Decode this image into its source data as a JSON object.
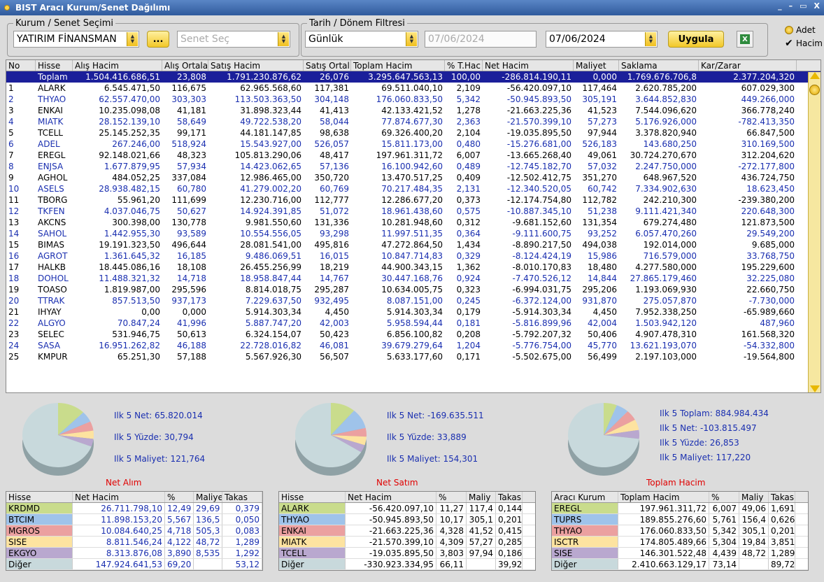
{
  "window": {
    "title": "BIST Aracı Kurum/Senet Dağılımı",
    "controls": [
      "_",
      "–",
      "▭",
      "X"
    ]
  },
  "filters": {
    "kurum_legend": "Kurum / Senet Seçimi",
    "kurum_value": "YATIRIM FİNANSMAN",
    "more_button": "...",
    "senet_placeholder": "Senet Seç",
    "tarih_legend": "Tarih / Dönem Filtresi",
    "period_value": "Günlük",
    "start_date": "07/06/2024",
    "end_date": "07/06/2024",
    "apply_button": "Uygula",
    "option_adet": "Adet",
    "option_hacim": "Hacim"
  },
  "table": {
    "columns": [
      "No",
      "Hisse",
      "Alış Hacim",
      "Alış Ortala",
      "Satış Hacim",
      "Satış Ortal",
      "Toplam Hacim",
      "% T.Hac",
      "Net Hacim",
      "Maliyet",
      "Saklama",
      "Kar/Zarar"
    ],
    "total": [
      "",
      "Toplam",
      "1.504.416.686,51",
      "23,808",
      "1.791.230.876,62",
      "26,076",
      "3.295.647.563,13",
      "100,00",
      "-286.814.190,11",
      "0,000",
      "1.769.676.706,8",
      "2.377.204,320"
    ],
    "rows": [
      [
        "1",
        "ALARK",
        "6.545.471,50",
        "116,675",
        "62.965.568,60",
        "117,381",
        "69.511.040,10",
        "2,109",
        "-56.420.097,10",
        "117,464",
        "2.620.785,200",
        "607.029,300"
      ],
      [
        "2",
        "THYAO",
        "62.557.470,00",
        "303,303",
        "113.503.363,50",
        "304,148",
        "176.060.833,50",
        "5,342",
        "-50.945.893,50",
        "305,191",
        "3.644.852,830",
        "449.266,000"
      ],
      [
        "3",
        "ENKAI",
        "10.235.098,08",
        "41,181",
        "31.898.323,44",
        "41,413",
        "42.133.421,52",
        "1,278",
        "-21.663.225,36",
        "41,523",
        "7.544.096,620",
        "366.778,240"
      ],
      [
        "4",
        "MIATK",
        "28.152.139,10",
        "58,649",
        "49.722.538,20",
        "58,044",
        "77.874.677,30",
        "2,363",
        "-21.570.399,10",
        "57,273",
        "5.176.926,000",
        "-782.413,350"
      ],
      [
        "5",
        "TCELL",
        "25.145.252,35",
        "99,171",
        "44.181.147,85",
        "98,638",
        "69.326.400,20",
        "2,104",
        "-19.035.895,50",
        "97,944",
        "3.378.820,940",
        "66.847,500"
      ],
      [
        "6",
        "ADEL",
        "267.246,00",
        "518,924",
        "15.543.927,00",
        "526,057",
        "15.811.173,00",
        "0,480",
        "-15.276.681,00",
        "526,183",
        "143.680,250",
        "310.169,500"
      ],
      [
        "7",
        "EREGL",
        "92.148.021,66",
        "48,323",
        "105.813.290,06",
        "48,417",
        "197.961.311,72",
        "6,007",
        "-13.665.268,40",
        "49,061",
        "30.724.270,670",
        "312.204,620"
      ],
      [
        "8",
        "ENJSA",
        "1.677.879,95",
        "57,934",
        "14.423.062,65",
        "57,136",
        "16.100.942,60",
        "0,489",
        "-12.745.182,70",
        "57,032",
        "2.247.750,000",
        "-272.177,800"
      ],
      [
        "9",
        "AGHOL",
        "484.052,25",
        "337,084",
        "12.986.465,00",
        "350,720",
        "13.470.517,25",
        "0,409",
        "-12.502.412,75",
        "351,270",
        "648.967,520",
        "436.724,750"
      ],
      [
        "10",
        "ASELS",
        "28.938.482,15",
        "60,780",
        "41.279.002,20",
        "60,769",
        "70.217.484,35",
        "2,131",
        "-12.340.520,05",
        "60,742",
        "7.334.902,630",
        "18.623,450"
      ],
      [
        "11",
        "TBORG",
        "55.961,20",
        "111,699",
        "12.230.716,00",
        "112,777",
        "12.286.677,20",
        "0,373",
        "-12.174.754,80",
        "112,782",
        "242.210,300",
        "-239.380,200"
      ],
      [
        "12",
        "TKFEN",
        "4.037.046,75",
        "50,627",
        "14.924.391,85",
        "51,072",
        "18.961.438,60",
        "0,575",
        "-10.887.345,10",
        "51,238",
        "9.111.421,340",
        "220.648,300"
      ],
      [
        "13",
        "AKCNS",
        "300.398,00",
        "130,778",
        "9.981.550,60",
        "131,336",
        "10.281.948,60",
        "0,312",
        "-9.681.152,60",
        "131,354",
        "679.274,480",
        "121.873,500"
      ],
      [
        "14",
        "SAHOL",
        "1.442.955,30",
        "93,589",
        "10.554.556,05",
        "93,298",
        "11.997.511,35",
        "0,364",
        "-9.111.600,75",
        "93,252",
        "6.057.470,260",
        "29.549,200"
      ],
      [
        "15",
        "BIMAS",
        "19.191.323,50",
        "496,644",
        "28.081.541,00",
        "495,816",
        "47.272.864,50",
        "1,434",
        "-8.890.217,50",
        "494,038",
        "192.014,000",
        "9.685,000"
      ],
      [
        "16",
        "AGROT",
        "1.361.645,32",
        "16,185",
        "9.486.069,51",
        "16,015",
        "10.847.714,83",
        "0,329",
        "-8.124.424,19",
        "15,986",
        "716.579,000",
        "33.768,750"
      ],
      [
        "17",
        "HALKB",
        "18.445.086,16",
        "18,108",
        "26.455.256,99",
        "18,219",
        "44.900.343,15",
        "1,362",
        "-8.010.170,83",
        "18,480",
        "4.277.580,000",
        "195.229,600"
      ],
      [
        "18",
        "DOHOL",
        "11.488.321,32",
        "14,718",
        "18.958.847,44",
        "14,767",
        "30.447.168,76",
        "0,924",
        "-7.470.526,12",
        "14,844",
        "27.865.179,460",
        "32.225,080"
      ],
      [
        "19",
        "TOASO",
        "1.819.987,00",
        "295,596",
        "8.814.018,75",
        "295,287",
        "10.634.005,75",
        "0,323",
        "-6.994.031,75",
        "295,206",
        "1.193.069,930",
        "22.660,750"
      ],
      [
        "20",
        "TTRAK",
        "857.513,50",
        "937,173",
        "7.229.637,50",
        "932,495",
        "8.087.151,00",
        "0,245",
        "-6.372.124,00",
        "931,870",
        "275.057,870",
        "-7.730,000"
      ],
      [
        "21",
        "IHYAY",
        "0,00",
        "0,000",
        "5.914.303,34",
        "4,450",
        "5.914.303,34",
        "0,179",
        "-5.914.303,34",
        "4,450",
        "7.952.338,250",
        "-65.989,660"
      ],
      [
        "22",
        "ALGYO",
        "70.847,24",
        "41,996",
        "5.887.747,20",
        "42,003",
        "5.958.594,44",
        "0,181",
        "-5.816.899,96",
        "42,004",
        "1.503.942,120",
        "487,960"
      ],
      [
        "23",
        "SELEC",
        "531.946,75",
        "50,613",
        "6.324.154,07",
        "50,423",
        "6.856.100,82",
        "0,208",
        "-5.792.207,32",
        "50,406",
        "4.907.478,310",
        "161.568,320"
      ],
      [
        "24",
        "SASA",
        "16.951.262,82",
        "46,188",
        "22.728.016,82",
        "46,081",
        "39.679.279,64",
        "1,204",
        "-5.776.754,00",
        "45,770",
        "13.621.193,070",
        "-54.332,800"
      ],
      [
        "25",
        "KMPUR",
        "65.251,30",
        "57,188",
        "5.567.926,30",
        "56,507",
        "5.633.177,60",
        "0,171",
        "-5.502.675,00",
        "56,499",
        "2.197.103,000",
        "-19.564,800"
      ]
    ]
  },
  "summaries": [
    {
      "title": "Net Alım",
      "stats": [
        "Ilk 5 Net: 65.820.014",
        "Ilk 5 Yüzde: 30,794",
        "Ilk 5 Maliyet: 121,764"
      ],
      "headers": [
        "Hisse",
        "Net Hacim",
        "%",
        "Maliye",
        "Takas"
      ],
      "pie": [
        12.49,
        5.567,
        4.718,
        4.122,
        3.89,
        69.2
      ],
      "rows": [
        {
          "c": [
            "KRDMD",
            "26.711.798,10",
            "12,49",
            "29,69",
            "0,379"
          ],
          "color": "#c9dc8c"
        },
        {
          "c": [
            "BTCIM",
            "11.898.153,20",
            "5,567",
            "136,5",
            "0,050"
          ],
          "color": "#9fc3ea"
        },
        {
          "c": [
            "MGROS",
            "10.084.640,25",
            "4,718",
            "505,3",
            "0,083"
          ],
          "color": "#eba0a0"
        },
        {
          "c": [
            "SISE",
            "8.811.546,24",
            "4,122",
            "48,72",
            "1,289"
          ],
          "color": "#fde3a0"
        },
        {
          "c": [
            "EKGYO",
            "8.313.876,08",
            "3,890",
            "8,535",
            "1,292"
          ],
          "color": "#b9a8cf"
        },
        {
          "c": [
            "Diğer",
            "147.924.641,53",
            "69,20",
            "",
            "53,12"
          ],
          "color": "#c8d9dc"
        }
      ]
    },
    {
      "title": "Net Satım",
      "stats": [
        "Ilk 5 Net: -169.635.511",
        "Ilk 5 Yüzde: 33,889",
        "Ilk 5 Maliyet: 154,301"
      ],
      "headers": [
        "Hisse",
        "Net Hacim",
        "%",
        "Maliy",
        "Takas"
      ],
      "pie": [
        11.27,
        10.17,
        4.328,
        4.309,
        3.803,
        66.11
      ],
      "rows": [
        {
          "c": [
            "ALARK",
            "-56.420.097,10",
            "11,27",
            "117,4",
            "0,144"
          ],
          "color": "#c9dc8c"
        },
        {
          "c": [
            "THYAO",
            "-50.945.893,50",
            "10,17",
            "305,1",
            "0,201"
          ],
          "color": "#9fc3ea"
        },
        {
          "c": [
            "ENKAI",
            "-21.663.225,36",
            "4,328",
            "41,52",
            "0,415"
          ],
          "color": "#eba0a0"
        },
        {
          "c": [
            "MIATK",
            "-21.570.399,10",
            "4,309",
            "57,27",
            "0,285"
          ],
          "color": "#fde3a0"
        },
        {
          "c": [
            "TCELL",
            "-19.035.895,50",
            "3,803",
            "97,94",
            "0,186"
          ],
          "color": "#b9a8cf"
        },
        {
          "c": [
            "Diğer",
            "-330.923.334,95",
            "66,11",
            "",
            "39,92"
          ],
          "color": "#c8d9dc"
        }
      ]
    },
    {
      "title": "Toplam Hacim",
      "stats": [
        "Ilk 5 Toplam: 884.984.434",
        "Ilk 5 Net: -103.815.497",
        "Ilk 5 Yüzde: 26,853",
        "Ilk 5 Maliyet: 117,220"
      ],
      "headers": [
        "Aracı Kurum",
        "Toplam Hacim",
        "%",
        "Maliy",
        "Takas"
      ],
      "pie": [
        6.007,
        5.761,
        5.342,
        5.304,
        4.439,
        73.14
      ],
      "rows": [
        {
          "c": [
            "EREGL",
            "197.961.311,72",
            "6,007",
            "49,06",
            "1,691"
          ],
          "color": "#c9dc8c"
        },
        {
          "c": [
            "TUPRS",
            "189.855.276,60",
            "5,761",
            "156,4",
            "0,626"
          ],
          "color": "#9fc3ea"
        },
        {
          "c": [
            "THYAO",
            "176.060.833,50",
            "5,342",
            "305,1",
            "0,201"
          ],
          "color": "#eba0a0"
        },
        {
          "c": [
            "ISCTR",
            "174.805.489,66",
            "5,304",
            "19,84",
            "3,851"
          ],
          "color": "#fde3a0"
        },
        {
          "c": [
            "SISE",
            "146.301.522,48",
            "4,439",
            "48,72",
            "1,289"
          ],
          "color": "#b9a8cf"
        },
        {
          "c": [
            "Diğer",
            "2.410.663.129,17",
            "73,14",
            "",
            "89,72"
          ],
          "color": "#c8d9dc"
        }
      ]
    }
  ]
}
